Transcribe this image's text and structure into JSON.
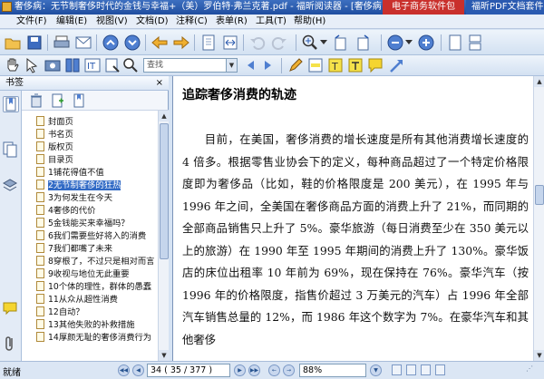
{
  "window": {
    "title": "奢侈病：无节制奢侈时代的金钱与幸福+（美）罗伯特·弗兰克著.pdf - 福昕阅读器 - [奢侈病：无节制奢侈时代",
    "ads": [
      "电子商务软件包",
      "福昕PDF文档套件"
    ]
  },
  "menu": [
    "文件(F)",
    "编辑(E)",
    "视图(V)",
    "文档(D)",
    "注释(C)",
    "表单(R)",
    "工具(T)",
    "帮助(H)"
  ],
  "toolbar": {
    "search_placeholder": "查找"
  },
  "side_panel": {
    "title": "书签",
    "close": "×"
  },
  "bookmarks": [
    "封面页",
    "书名页",
    "版权页",
    "目录页",
    "1铺花得值不值",
    "2无节制奢侈的狂热",
    "3为何发生在今天",
    "4奢侈的代价",
    "5金钱能买来幸福吗？",
    "6我们需要些好将入的消费",
    "7我们都嘴了未来",
    "8穿根了，不过只是相对而言",
    "9收视与地位无此重要",
    "10个体的理性，群体的愚蠢",
    "11从众从超性消费",
    "12自动？",
    "13其他失败的补救措施",
    "14厚颜无耻的奢侈消费行为"
  ],
  "selected_bookmark": 1,
  "document": {
    "heading": "追踪奢侈消费的轨迹",
    "paragraph": "目前，在美国，奢侈消费的增长速度是所有其他消费增长速度的 4 倍多。根据零售业协会下的定义，每种商品超过了一个特定价格限度即为奢侈品（比如，鞋的价格限度是 200 美元），在 1995 年与 1996 年之间，全美国在奢侈商品方面的消费上升了 21%，而同期的全部商品销售只上升了 5%。豪华旅游（每日消费至少在 350 美元以上的旅游）在 1990 年至 1995 年期间的消费上升了 130%。豪华饭店的床位出租率 10 年前为 69%，现在保持在 76%。豪华汽车（按 1996 年的价格限度，指售价超过 3 万美元的汽车）占 1996 年全部汽车销售总量的 12%，而 1986 年这个数字为 7%。在豪华汽车和其他奢侈"
  },
  "status": {
    "ready": "就绪",
    "page": "34",
    "page_of": "( 35 / 377 )",
    "zoom": "88%"
  }
}
